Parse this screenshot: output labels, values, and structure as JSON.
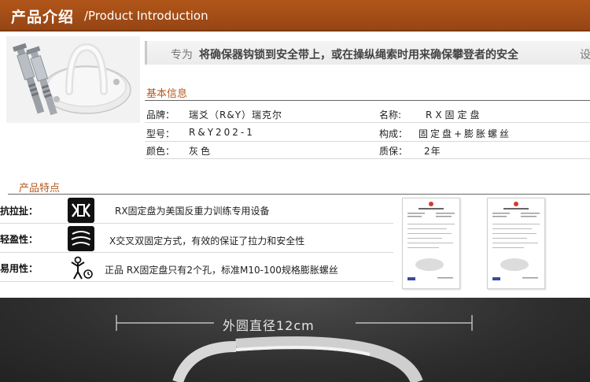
{
  "header": {
    "title": "产品介绍",
    "subtitle": "/Product Introduction"
  },
  "slogan": {
    "part1": "专为",
    "part2": "将确保器钩锁到安全带上，或在操纵绳索时用来确保攀登者的安全",
    "part3": "设计"
  },
  "basic_info": {
    "title": "基本信息",
    "rows": [
      {
        "label1": "品牌：",
        "value1": "瑞爻（R&Y）瑞克尔",
        "label2": "名称:",
        "value2": "RX固定盘"
      },
      {
        "label1": "型号：",
        "value1": "R&Y202-1",
        "label2": "构成：",
        "value2": "固定盘+膨胀螺丝"
      },
      {
        "label1": "颜色：",
        "value1": "灰色",
        "label2": "质保：",
        "value2": "2年"
      }
    ]
  },
  "features": {
    "title": "产品特点",
    "items": [
      {
        "label": "抗拉扯：",
        "icon": "tension-icon",
        "text": "RX固定盘为美国反重力训练专用设备"
      },
      {
        "label": "轻盈性：",
        "icon": "lightweight-icon",
        "text": "X交叉双固定方式，有效的保证了拉力和安全性"
      },
      {
        "label": "易用性：",
        "icon": "easy-use-icon",
        "text": "正品 RX固定盘只有2个孔，标准M10-100规格膨胀螺丝"
      }
    ]
  },
  "dimension": {
    "label": "外圆直径12cm"
  },
  "colors": {
    "banner": "#a24d17",
    "accent": "#b5591c",
    "panel": "#2e2e2e"
  }
}
